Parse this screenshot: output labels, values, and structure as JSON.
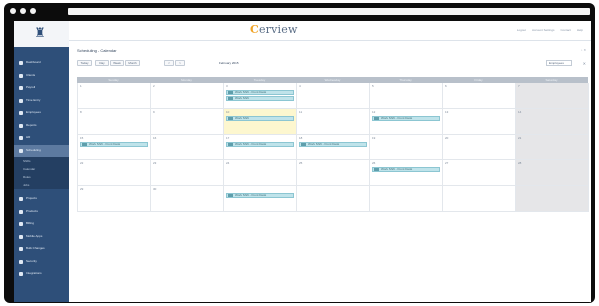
{
  "app": {
    "brand_prefix": "C",
    "brand_rest": "erview",
    "window_dots": [
      "dot-1",
      "dot-2",
      "dot-3"
    ]
  },
  "top_links": [
    "Logout",
    "Account Settings",
    "Contact",
    "Help"
  ],
  "sidebar": {
    "logo_icon": "home-logo-icon",
    "items": [
      {
        "label": "Dashboard",
        "icon": "dashboard-icon"
      },
      {
        "label": "Clients",
        "icon": "clients-icon"
      },
      {
        "label": "Payroll",
        "icon": "payroll-icon"
      },
      {
        "label": "Time Entry",
        "icon": "clock-icon"
      },
      {
        "label": "Employees",
        "icon": "employees-icon"
      },
      {
        "label": "Reports",
        "icon": "reports-icon"
      },
      {
        "label": "HR",
        "icon": "hr-icon"
      },
      {
        "label": "Scheduling",
        "icon": "calendar-icon",
        "active": true
      }
    ],
    "subitems": [
      "Shifts",
      "Calendar",
      "Rules",
      "Jobs"
    ],
    "items_bottom": [
      {
        "label": "Projects",
        "icon": "projects-icon"
      },
      {
        "label": "Products",
        "icon": "products-icon"
      },
      {
        "label": "Billing",
        "icon": "billing-icon"
      },
      {
        "label": "Mobile Apps",
        "icon": "mobile-icon"
      },
      {
        "label": "Bulk Changes",
        "icon": "bulk-icon"
      },
      {
        "label": "Security",
        "icon": "lock-icon"
      },
      {
        "label": "Integrations",
        "icon": "plug-icon"
      }
    ]
  },
  "page": {
    "title": "Scheduling - Calendar",
    "corner_icons": "↓  ✕"
  },
  "toolbar": {
    "buttons": [
      "Today",
      "Day",
      "Week",
      "Month",
      "<",
      ">"
    ],
    "month_label": "February 2015",
    "view_select": "Employees",
    "close": "✕"
  },
  "calendar": {
    "days": [
      "Sunday",
      "Monday",
      "Tuesday",
      "Wednesday",
      "Thursday",
      "Friday",
      "Saturday"
    ],
    "weeks": [
      [
        "1",
        "2",
        "3",
        "4",
        "5",
        "6",
        "7"
      ],
      [
        "8",
        "9",
        "10",
        "11",
        "12",
        "13",
        "14"
      ],
      [
        "15",
        "16",
        "17",
        "18",
        "19",
        "20",
        "21"
      ],
      [
        "22",
        "23",
        "24",
        "25",
        "26",
        "27",
        "28"
      ],
      [
        "29",
        "30",
        "",
        "",
        "",
        "",
        ""
      ]
    ],
    "events": [
      {
        "text": "Work Shift - Front Desk",
        "week": 0,
        "day": 2,
        "slot": 0
      },
      {
        "text": "Work Shift",
        "week": 0,
        "day": 2,
        "slot": 1
      },
      {
        "text": "Work Shift - Front Desk",
        "week": 1,
        "day": 4,
        "slot": 0
      },
      {
        "text": "Work Shift",
        "week": 1,
        "day": 2,
        "slot": 0
      },
      {
        "text": "Work Shift - Front Desk",
        "week": 2,
        "day": 0,
        "slot": 0
      },
      {
        "text": "Work Shift - Front Desk",
        "week": 2,
        "day": 2,
        "slot": 0
      },
      {
        "text": "Work Shift - Front Desk",
        "week": 2,
        "day": 3,
        "slot": 0
      },
      {
        "text": "Work Shift - Front Desk",
        "week": 3,
        "day": 4,
        "slot": 0
      },
      {
        "text": "Work Shift - Front Desk",
        "week": 4,
        "day": 2,
        "slot": 0
      }
    ]
  }
}
